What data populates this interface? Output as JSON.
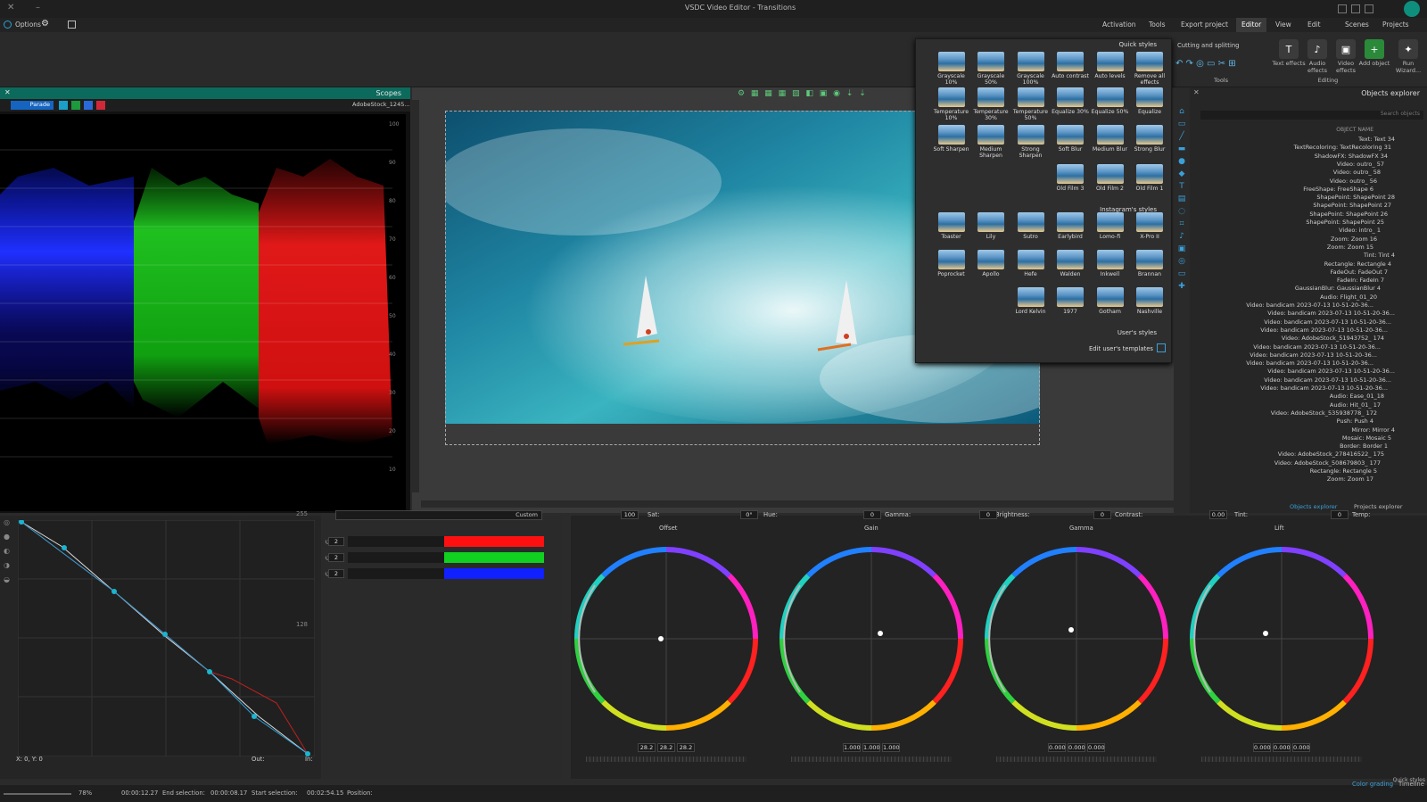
{
  "window": {
    "title": "VSDC Video Editor - Transitions"
  },
  "menu": {
    "items": [
      "Projects",
      "Scenes",
      "Editor",
      "View",
      "Edit",
      "Activation",
      "Tools",
      "Export project",
      "Activation"
    ],
    "active": "Editor",
    "options": "Options"
  },
  "menu_labels": {
    "projects": "Projects",
    "scenes": "Scenes",
    "editor": "Editor",
    "view": "View",
    "edit": "Edit",
    "export": "Export project",
    "tools": "Tools",
    "activation": "Activation",
    "options": "Options"
  },
  "ribbon": {
    "run_wizard": "Run Wizard...",
    "add_object": "Add object",
    "video_effects": "Video effects",
    "audio_effects": "Audio effects",
    "text_effects": "Text effects",
    "editing": "Editing",
    "tools": "Tools",
    "cutting": "Cutting and splitting"
  },
  "scopes": {
    "title": "Scopes",
    "mode": "Parade",
    "source": "AdobeStock_1245...",
    "ticks": [
      "100",
      "90",
      "80",
      "70",
      "60",
      "50",
      "40",
      "30",
      "20",
      "10"
    ]
  },
  "quick_styles": {
    "header": "Quick styles",
    "row1": [
      "Remove all effects",
      "Auto levels",
      "Auto contrast",
      "Grayscale 100%",
      "Grayscale 50%",
      "Grayscale 10%"
    ],
    "row2": [
      "Equalize",
      "Equalize 50%",
      "Equalize 30%",
      "Temperature 50%",
      "Temperature 30%",
      "Temperature 10%"
    ],
    "row3": [
      "Strong Blur",
      "Medium Blur",
      "Soft Blur",
      "Strong Sharpen",
      "Medium Sharpen",
      "Soft Sharpen"
    ],
    "row4": [
      "Old Film 1",
      "Old Film 2",
      "Old Film 3"
    ],
    "instagram_header": "Instagram's styles",
    "row5": [
      "X-Pro II",
      "Lomo-fi",
      "Earlybird",
      "Sutro",
      "Lily",
      "Toaster"
    ],
    "row6": [
      "Brannan",
      "Inkwell",
      "Walden",
      "Hefe",
      "Apollo",
      "Poprocket"
    ],
    "row7": [
      "Nashville",
      "Gotham",
      "1977",
      "Lord Kelvin"
    ],
    "user_header": "User's styles",
    "edit_templates": "Edit user's templates"
  },
  "explorer": {
    "title": "Objects explorer",
    "search": "Search objects",
    "column": "OBJECT NAME",
    "tab_projects": "Projects explorer",
    "tab_objects": "Objects explorer",
    "items": [
      "Text: Text 34",
      "TextRecoloring: TextRecoloring 31",
      "ShadowFX: ShadowFX 34",
      "Video: outro_ 57",
      "Video: outro_ 58",
      "Video: outro_ 56",
      "FreeShape: FreeShape 6",
      "ShapePoint: ShapePoint 28",
      "ShapePoint: ShapePoint 27",
      "ShapePoint: ShapePoint 26",
      "ShapePoint: ShapePoint 25",
      "Video: intro_ 1",
      "Zoom: Zoom 16",
      "Zoom: Zoom 15",
      "Tint: Tint 4",
      "Rectangle: Rectangle 4",
      "FadeOut: FadeOut 7",
      "FadeIn: FadeIn 7",
      "GaussianBlur: GaussianBlur 4",
      "Audio: Flight_01_20",
      "Video: bandicam 2023-07-13 10-51-20-36...",
      "Video: bandicam 2023-07-13 10-51-20-36...",
      "Video: bandicam 2023-07-13 10-51-20-36...",
      "Video: bandicam 2023-07-13 10-51-20-36...",
      "Video: AdobeStock_51943752_ 174",
      "Video: bandicam 2023-07-13 10-51-20-36...",
      "Video: bandicam 2023-07-13 10-51-20-36...",
      "Video: bandicam 2023-07-13 10-51-20-36...",
      "Video: bandicam 2023-07-13 10-51-20-36...",
      "Video: bandicam 2023-07-13 10-51-20-36...",
      "Video: bandicam 2023-07-13 10-51-20-36...",
      "Audio: Ease_01_18",
      "Audio: Hit_01_ 17",
      "Video: AdobeStock_535938778_ 172",
      "Push: Push 4",
      "Mirror: Mirror 4",
      "Mosaic: Mosaic 5",
      "Border: Border 1",
      "Video: AdobeStock_278416522_ 175",
      "Video: AdobeStock_508679803_ 177",
      "Rectangle: Rectangle 5",
      "Zoom: Zoom 17"
    ]
  },
  "color": {
    "mode": "Custom",
    "channels": [
      "2",
      "2",
      "2"
    ],
    "coords": "X: 0, Y: 0",
    "out_label": "Out:",
    "in_label": "In:",
    "axis_max": "255",
    "axis_mid": "128"
  },
  "wheels": {
    "temp_label": "Temp:",
    "temp": "0",
    "tint_label": "Tint:",
    "tint": "0.00",
    "contrast_label": "Contrast:",
    "contrast": "0",
    "brightness_label": "Brightness:",
    "brightness": "0",
    "gamma_label": "Gamma:",
    "gamma": "0",
    "hue_label": "Hue:",
    "hue": "0°",
    "sat_label": "Sat:",
    "sat": "100",
    "names": [
      "Offset",
      "Gain",
      "Gamma",
      "Lift"
    ],
    "values": [
      [
        "28.2",
        "28.2",
        "28.2"
      ],
      [
        "1.000",
        "1.000",
        "1.000"
      ],
      [
        "0.000",
        "0.000",
        "0.000"
      ],
      [
        "0.000",
        "0.000",
        "0.000"
      ]
    ]
  },
  "status": {
    "position_label": "Position:",
    "position": "00:02:54.15",
    "start_label": "Start selection:",
    "start": "00:00:08.17",
    "end_label": "End selection:",
    "end": "00:00:12.27",
    "zoom": "78%",
    "tab_timeline": "Timeline",
    "tab_color": "Color grading",
    "tab_quick": "Quick styles"
  }
}
